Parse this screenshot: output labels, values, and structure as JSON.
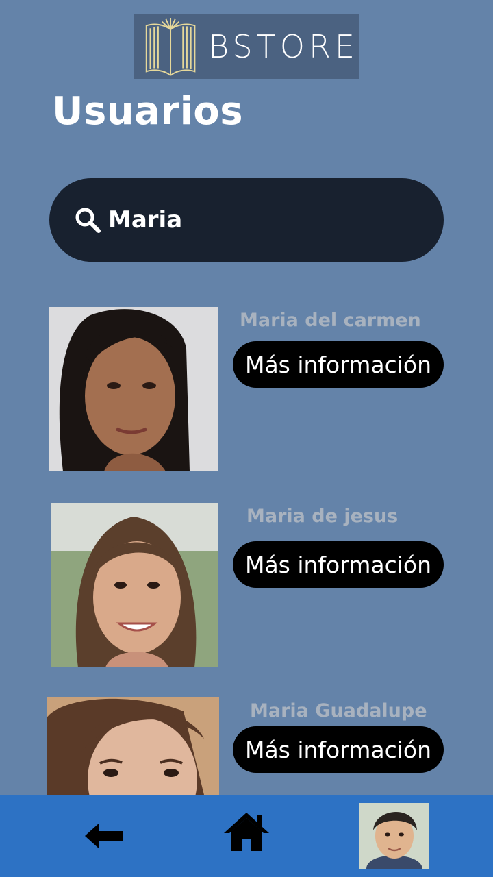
{
  "header": {
    "brand": "BSTORE",
    "title": "Usuarios"
  },
  "search": {
    "value": "Maria",
    "icon": "search-icon"
  },
  "users": [
    {
      "name": "Maria del carmen",
      "button_label": "Más información"
    },
    {
      "name": "Maria de jesus",
      "button_label": "Más información"
    },
    {
      "name": "Maria Guadalupe",
      "button_label": "Más información"
    }
  ],
  "bottom_nav": {
    "items": [
      "arrow-left-icon",
      "home-icon",
      "profile-avatar"
    ]
  },
  "colors": {
    "background": "#6483a9",
    "search_bg": "#18212f",
    "bottom_bar": "#2d72c4",
    "button_bg": "#000000",
    "name_text": "#a8b2bf"
  }
}
